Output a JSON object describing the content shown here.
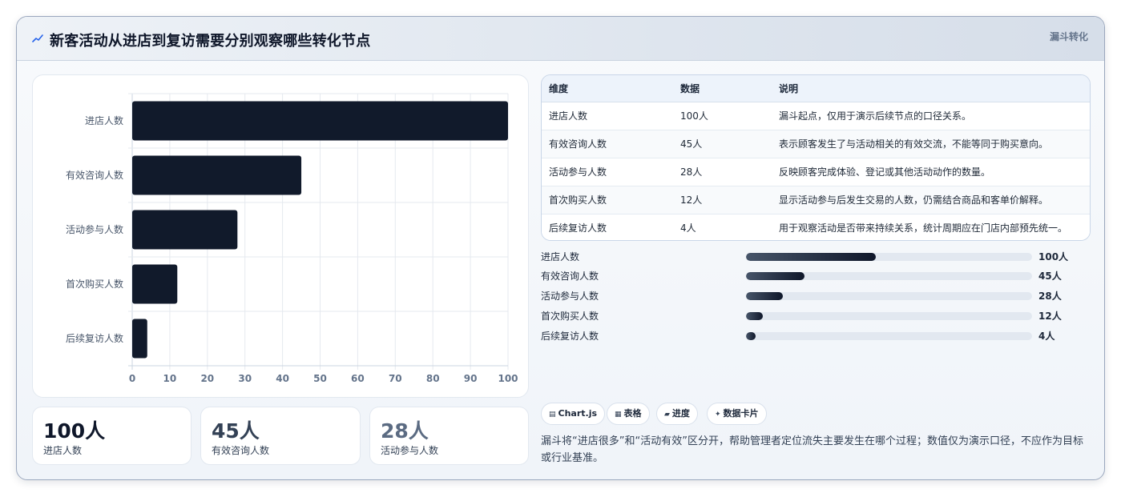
{
  "header": {
    "title": "新客活动从进店到复访需要分别观察哪些转化节点",
    "tag": "漏斗转化"
  },
  "chart_data": {
    "type": "bar",
    "orientation": "horizontal",
    "categories": [
      "进店人数",
      "有效咨询人数",
      "活动参与人数",
      "首次购买人数",
      "后续复访人数"
    ],
    "values": [
      100,
      45,
      28,
      12,
      4
    ],
    "xlim": [
      0,
      100
    ],
    "xticks": [
      "0",
      "10",
      "20",
      "30",
      "40",
      "50",
      "60",
      "70",
      "80",
      "90",
      "100"
    ],
    "grid": true,
    "bar_color": "#111a2b"
  },
  "stats": [
    {
      "value": "100人",
      "label": "进店人数",
      "color": "#0f172a"
    },
    {
      "value": "45人",
      "label": "有效咨询人数",
      "color": "#334155"
    },
    {
      "value": "28人",
      "label": "活动参与人数",
      "color": "#5b6b82"
    }
  ],
  "table": {
    "headers": [
      "维度",
      "数据",
      "说明"
    ],
    "rows": [
      [
        "进店人数",
        "100人",
        "漏斗起点，仅用于演示后续节点的口径关系。"
      ],
      [
        "有效咨询人数",
        "45人",
        "表示顾客发生了与活动相关的有效交流，不能等同于购买意向。"
      ],
      [
        "活动参与人数",
        "28人",
        "反映顾客完成体验、登记或其他活动动作的数量。"
      ],
      [
        "首次购买人数",
        "12人",
        "显示活动参与后发生交易的人数，仍需结合商品和客单价解释。"
      ],
      [
        "后续复访人数",
        "4人",
        "用于观察活动是否带来持续关系，统计周期应在门店内部预先统一。"
      ]
    ]
  },
  "progress": [
    {
      "label": "进店人数",
      "value": "100人",
      "fraction": 0.455
    },
    {
      "label": "有效咨询人数",
      "value": "45人",
      "fraction": 0.205
    },
    {
      "label": "活动参与人数",
      "value": "28人",
      "fraction": 0.13
    },
    {
      "label": "首次购买人数",
      "value": "12人",
      "fraction": 0.06
    },
    {
      "label": "后续复访人数",
      "value": "4人",
      "fraction": 0.035
    }
  ],
  "chips": [
    {
      "icon": "chart-icon",
      "glyph": "▤",
      "label": "Chart.js"
    },
    {
      "icon": "table-icon",
      "glyph": "▦",
      "label": "表格"
    },
    {
      "icon": "progress-icon",
      "glyph": "▰",
      "label": "进度"
    },
    {
      "icon": "sparkle-icon",
      "glyph": "✦",
      "label": "数据卡片"
    }
  ],
  "footnote": "漏斗将“进店很多”和“活动有效”区分开，帮助管理者定位流失主要发生在哪个过程；数值仅为演示口径，不应作为目标或行业基准。"
}
